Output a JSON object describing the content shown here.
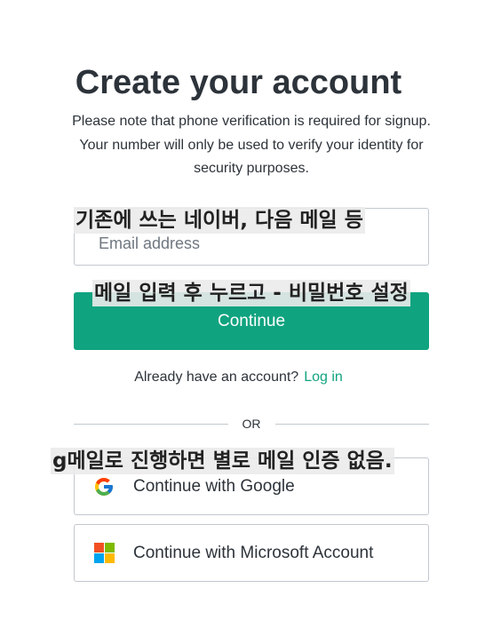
{
  "header": {
    "title": "Create your account",
    "subtitle": "Please note that phone verification is required for signup. Your number will only be used to verify your identity for security purposes."
  },
  "form": {
    "email_placeholder": "Email address",
    "continue_label": "Continue"
  },
  "login": {
    "prompt": "Already have an account?",
    "link_label": "Log in"
  },
  "divider": {
    "label": "OR"
  },
  "social": {
    "google_label": "Continue with Google",
    "microsoft_label": "Continue with Microsoft Account",
    "google_icon": "google-logo-icon",
    "microsoft_icon": "microsoft-logo-icon"
  },
  "annotations": {
    "note_1": "기존에 쓰는 네이버, 다음 메일 등",
    "note_2": "메일 입력 후 누르고 - 비밀번호 설정",
    "note_3": "g메일로 진행하면 별로 메일 인증 없음."
  },
  "colors": {
    "accent": "#10a37f",
    "text": "#2d333a",
    "border": "#c2c8d0"
  }
}
